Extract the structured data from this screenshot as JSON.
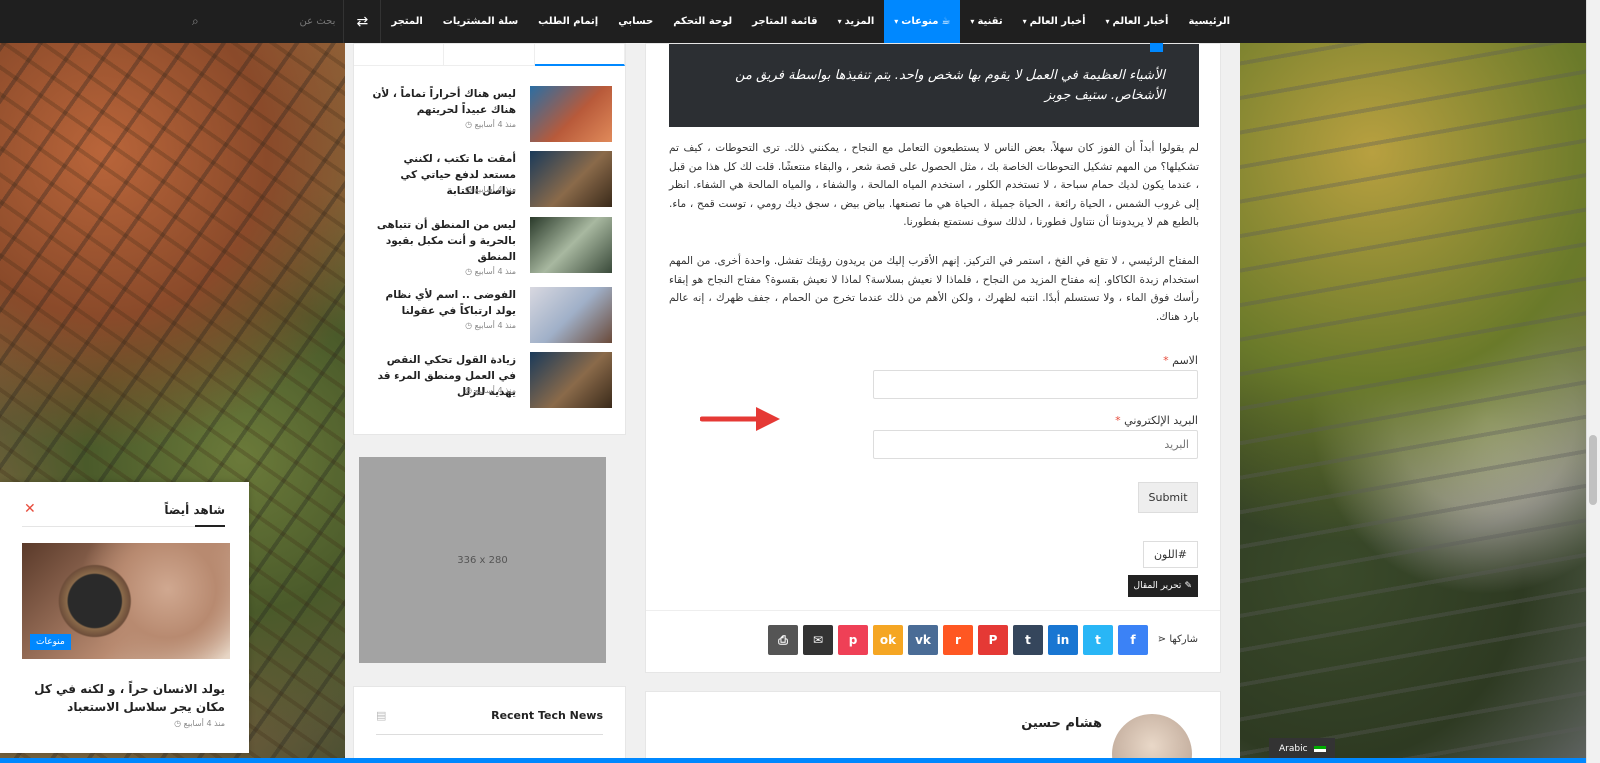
{
  "nav": {
    "items": [
      {
        "label": "الرئيسية",
        "caret": false,
        "active": false
      },
      {
        "label": "أخبار العالم",
        "caret": true,
        "active": false
      },
      {
        "label": "أخبار العالم",
        "caret": true,
        "active": false
      },
      {
        "label": "تقنية",
        "caret": true,
        "active": false
      },
      {
        "label": "منوعات",
        "caret": true,
        "active": true,
        "icon": "coffee-icon"
      },
      {
        "label": "المزيد",
        "caret": true,
        "active": false
      },
      {
        "label": "قائمة المتاجر",
        "caret": false,
        "active": false
      },
      {
        "label": "لوحة التحكم",
        "caret": false,
        "active": false
      },
      {
        "label": "حسابي",
        "caret": false,
        "active": false
      },
      {
        "label": "إتمام الطلب",
        "caret": false,
        "active": false
      },
      {
        "label": "سلة المشتريات",
        "caret": false,
        "active": false
      },
      {
        "label": "المتجر",
        "caret": false,
        "active": false
      }
    ],
    "search_placeholder": "بحث عن",
    "shuffle_icon": "shuffle-icon",
    "search_icon": "search-icon",
    "active_color": "#0088ff"
  },
  "article": {
    "quote": "الأشياء العظيمة في العمل لا يقوم بها شخص واحد. يتم تنفيذها بواسطة فريق من الأشخاص. ستيف جوبز",
    "paragraph1": "لم يقولوا أبداً أن الفوز كان سهلاً. بعض الناس لا يستطيعون التعامل مع النجاح ، يمكنني ذلك. ترى التحوطات ، كيف تم تشكيلها؟ من المهم تشكيل التحوطات الخاصة بك ، مثل الحصول على قصة شعر ، والبقاء منتعشًا. قلت لك كل هذا من قبل ، عندما يكون لديك حمام سباحة ، لا تستخدم الكلور ، استخدم المياه المالحة ، والشفاء ، والمياه المالحة هي الشفاء. انظر إلى غروب الشمس ، الحياة رائعة ، الحياة جميلة ، الحياة هي ما تصنعها. بياض بيض ، سجق ديك رومي ، توست قمح ، ماء. بالطبع هم لا يريدوننا أن نتناول فطورنا ، لذلك سوف نستمتع بفطورنا.",
    "paragraph2": "المفتاح الرئيسي ، لا تقع في الفخ ، استمر في التركيز. إنهم الأقرب إليك من يريدون رؤيتك تفشل. واحدة أخرى. من المهم استخدام زبدة الكاكاو. إنه مفتاح المزيد من النجاح ، فلماذا لا نعيش بسلاسة؟ لماذا لا نعيش بقسوة؟ مفتاح النجاح هو إبقاء رأسك فوق الماء ، ولا تستسلم أبدًا. انتبه لظهرك ، ولكن الأهم من ذلك عندما تخرج من الحمام ، جفف ظهرك ، إنه عالم بارد هناك.",
    "form": {
      "name_label": "الاسم",
      "email_label": "البريد الإلكتروني",
      "required_mark": "*",
      "email_placeholder": "البريد",
      "submit_label": "Submit"
    },
    "tag_label": "#اللون",
    "edit_label": "تحرير المقال",
    "share_label": "شاركها"
  },
  "share_buttons": [
    {
      "name": "facebook",
      "glyph": "f",
      "color": "#3b82f6"
    },
    {
      "name": "twitter",
      "glyph": "t",
      "color": "#29b6f6"
    },
    {
      "name": "linkedin",
      "glyph": "in",
      "color": "#1976d2"
    },
    {
      "name": "tumblr",
      "glyph": "t",
      "color": "#35465c"
    },
    {
      "name": "pinterest",
      "glyph": "P",
      "color": "#e53935"
    },
    {
      "name": "reddit",
      "glyph": "r",
      "color": "#ff5722"
    },
    {
      "name": "vk",
      "glyph": "vk",
      "color": "#4a6c96"
    },
    {
      "name": "odnoklassniki",
      "glyph": "ok",
      "color": "#f5a623"
    },
    {
      "name": "pocket",
      "glyph": "p",
      "color": "#ef4056"
    },
    {
      "name": "email",
      "glyph": "✉",
      "color": "#333333"
    },
    {
      "name": "print",
      "glyph": "⎙",
      "color": "#555555"
    }
  ],
  "author": {
    "name": "هشام حسين"
  },
  "sidebar": {
    "posts": [
      {
        "title": "ليس هناك أحراراً تماماً ، لأن هناك عبيداً لحريتهم",
        "date": "منذ 4 أسابيع",
        "thumb": "linear-gradient(135deg,#2b6ea3,#b85a3a 55%,#e08a5a)"
      },
      {
        "title": "أمقت ما تكتب ، لكنني مستعد لدفع حياتي كي تواصل الكتابة",
        "date": "منذ 4 أسابيع",
        "thumb": "linear-gradient(135deg,#1a3a5a,#8a6a4a 55%,#3a2a1a)"
      },
      {
        "title": "ليس من المنطق أن تتباهى بالحرية و أنت مكبل بقيود المنطق",
        "date": "منذ 4 أسابيع",
        "thumb": "linear-gradient(135deg,#2a3a2a,#a8b8a0 50%,#3a4a3a)"
      },
      {
        "title": "الفوضى .. اسم لأي نظام يولد ارتباكاً في عقولنا",
        "date": "منذ 4 أسابيع",
        "thumb": "linear-gradient(135deg,#d8d8e0,#a0b0c8 50%,#6a4a3a)"
      },
      {
        "title": "زيادة القول تحكي النقص في العمل ومنطق المرء قد يهديه للزلل",
        "date": "منذ 4 أسابيع",
        "thumb": "linear-gradient(135deg,#1a3a5a,#8a6a4a 55%,#3a2a1a)"
      }
    ],
    "ad_label": "336 x 280",
    "widget_title": "Recent Tech News"
  },
  "popup": {
    "title": "شاهد أيضاً",
    "badge": "منوعات",
    "headline": "يولد الانسان حراً ، و لكنه في كل مكان يجر سلاسل الاستعباد",
    "date": "منذ 4 أسابيع"
  },
  "language": {
    "label": "Arabic"
  }
}
